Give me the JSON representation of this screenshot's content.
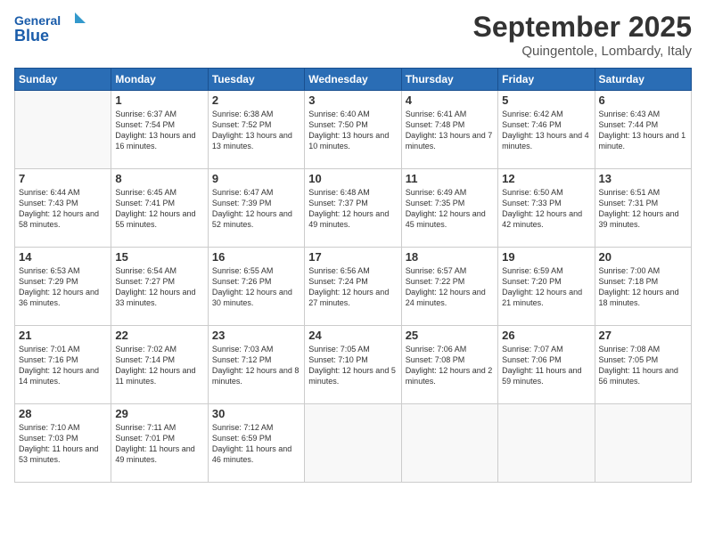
{
  "header": {
    "logo_general": "General",
    "logo_blue": "Blue",
    "month": "September 2025",
    "location": "Quingentole, Lombardy, Italy"
  },
  "weekdays": [
    "Sunday",
    "Monday",
    "Tuesday",
    "Wednesday",
    "Thursday",
    "Friday",
    "Saturday"
  ],
  "weeks": [
    [
      {
        "day": "",
        "text": ""
      },
      {
        "day": "1",
        "text": "Sunrise: 6:37 AM\nSunset: 7:54 PM\nDaylight: 13 hours\nand 16 minutes."
      },
      {
        "day": "2",
        "text": "Sunrise: 6:38 AM\nSunset: 7:52 PM\nDaylight: 13 hours\nand 13 minutes."
      },
      {
        "day": "3",
        "text": "Sunrise: 6:40 AM\nSunset: 7:50 PM\nDaylight: 13 hours\nand 10 minutes."
      },
      {
        "day": "4",
        "text": "Sunrise: 6:41 AM\nSunset: 7:48 PM\nDaylight: 13 hours\nand 7 minutes."
      },
      {
        "day": "5",
        "text": "Sunrise: 6:42 AM\nSunset: 7:46 PM\nDaylight: 13 hours\nand 4 minutes."
      },
      {
        "day": "6",
        "text": "Sunrise: 6:43 AM\nSunset: 7:44 PM\nDaylight: 13 hours\nand 1 minute."
      }
    ],
    [
      {
        "day": "7",
        "text": "Sunrise: 6:44 AM\nSunset: 7:43 PM\nDaylight: 12 hours\nand 58 minutes."
      },
      {
        "day": "8",
        "text": "Sunrise: 6:45 AM\nSunset: 7:41 PM\nDaylight: 12 hours\nand 55 minutes."
      },
      {
        "day": "9",
        "text": "Sunrise: 6:47 AM\nSunset: 7:39 PM\nDaylight: 12 hours\nand 52 minutes."
      },
      {
        "day": "10",
        "text": "Sunrise: 6:48 AM\nSunset: 7:37 PM\nDaylight: 12 hours\nand 49 minutes."
      },
      {
        "day": "11",
        "text": "Sunrise: 6:49 AM\nSunset: 7:35 PM\nDaylight: 12 hours\nand 45 minutes."
      },
      {
        "day": "12",
        "text": "Sunrise: 6:50 AM\nSunset: 7:33 PM\nDaylight: 12 hours\nand 42 minutes."
      },
      {
        "day": "13",
        "text": "Sunrise: 6:51 AM\nSunset: 7:31 PM\nDaylight: 12 hours\nand 39 minutes."
      }
    ],
    [
      {
        "day": "14",
        "text": "Sunrise: 6:53 AM\nSunset: 7:29 PM\nDaylight: 12 hours\nand 36 minutes."
      },
      {
        "day": "15",
        "text": "Sunrise: 6:54 AM\nSunset: 7:27 PM\nDaylight: 12 hours\nand 33 minutes."
      },
      {
        "day": "16",
        "text": "Sunrise: 6:55 AM\nSunset: 7:26 PM\nDaylight: 12 hours\nand 30 minutes."
      },
      {
        "day": "17",
        "text": "Sunrise: 6:56 AM\nSunset: 7:24 PM\nDaylight: 12 hours\nand 27 minutes."
      },
      {
        "day": "18",
        "text": "Sunrise: 6:57 AM\nSunset: 7:22 PM\nDaylight: 12 hours\nand 24 minutes."
      },
      {
        "day": "19",
        "text": "Sunrise: 6:59 AM\nSunset: 7:20 PM\nDaylight: 12 hours\nand 21 minutes."
      },
      {
        "day": "20",
        "text": "Sunrise: 7:00 AM\nSunset: 7:18 PM\nDaylight: 12 hours\nand 18 minutes."
      }
    ],
    [
      {
        "day": "21",
        "text": "Sunrise: 7:01 AM\nSunset: 7:16 PM\nDaylight: 12 hours\nand 14 minutes."
      },
      {
        "day": "22",
        "text": "Sunrise: 7:02 AM\nSunset: 7:14 PM\nDaylight: 12 hours\nand 11 minutes."
      },
      {
        "day": "23",
        "text": "Sunrise: 7:03 AM\nSunset: 7:12 PM\nDaylight: 12 hours\nand 8 minutes."
      },
      {
        "day": "24",
        "text": "Sunrise: 7:05 AM\nSunset: 7:10 PM\nDaylight: 12 hours\nand 5 minutes."
      },
      {
        "day": "25",
        "text": "Sunrise: 7:06 AM\nSunset: 7:08 PM\nDaylight: 12 hours\nand 2 minutes."
      },
      {
        "day": "26",
        "text": "Sunrise: 7:07 AM\nSunset: 7:06 PM\nDaylight: 11 hours\nand 59 minutes."
      },
      {
        "day": "27",
        "text": "Sunrise: 7:08 AM\nSunset: 7:05 PM\nDaylight: 11 hours\nand 56 minutes."
      }
    ],
    [
      {
        "day": "28",
        "text": "Sunrise: 7:10 AM\nSunset: 7:03 PM\nDaylight: 11 hours\nand 53 minutes."
      },
      {
        "day": "29",
        "text": "Sunrise: 7:11 AM\nSunset: 7:01 PM\nDaylight: 11 hours\nand 49 minutes."
      },
      {
        "day": "30",
        "text": "Sunrise: 7:12 AM\nSunset: 6:59 PM\nDaylight: 11 hours\nand 46 minutes."
      },
      {
        "day": "",
        "text": ""
      },
      {
        "day": "",
        "text": ""
      },
      {
        "day": "",
        "text": ""
      },
      {
        "day": "",
        "text": ""
      }
    ]
  ]
}
